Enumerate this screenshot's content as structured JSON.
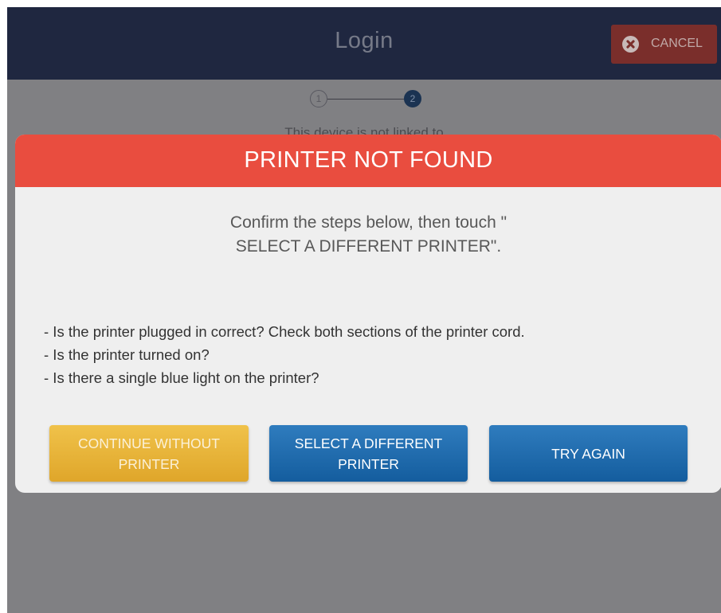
{
  "header": {
    "title": "Login",
    "cancel_label": "CANCEL"
  },
  "stepper": {
    "steps": [
      "1",
      "2"
    ],
    "active_step": 2
  },
  "background_text": "This device is not linked to",
  "modal": {
    "title": "PRINTER NOT FOUND",
    "instructions": "Confirm the steps below, then touch \"\nSELECT A DIFFERENT PRINTER\".",
    "checklist": [
      "- Is the printer plugged in correct?  Check both sections of the printer cord.",
      "- Is the printer turned on?",
      "- Is there a single blue light on the printer?"
    ],
    "buttons": {
      "continue": "CONTINUE WITHOUT\nPRINTER",
      "select": "SELECT A DIFFERENT\nPRINTER",
      "retry": "TRY AGAIN"
    }
  },
  "colors": {
    "header_bg": "#1f2740",
    "cancel_bg": "#7a2e2b",
    "overlay_bg": "#808083",
    "modal_header": "#e94d3f",
    "modal_bg": "#efefef",
    "continue_button": "#e5b034",
    "blue_button": "#1f6aab"
  },
  "icons": {
    "cancel": "close-circle-icon"
  }
}
